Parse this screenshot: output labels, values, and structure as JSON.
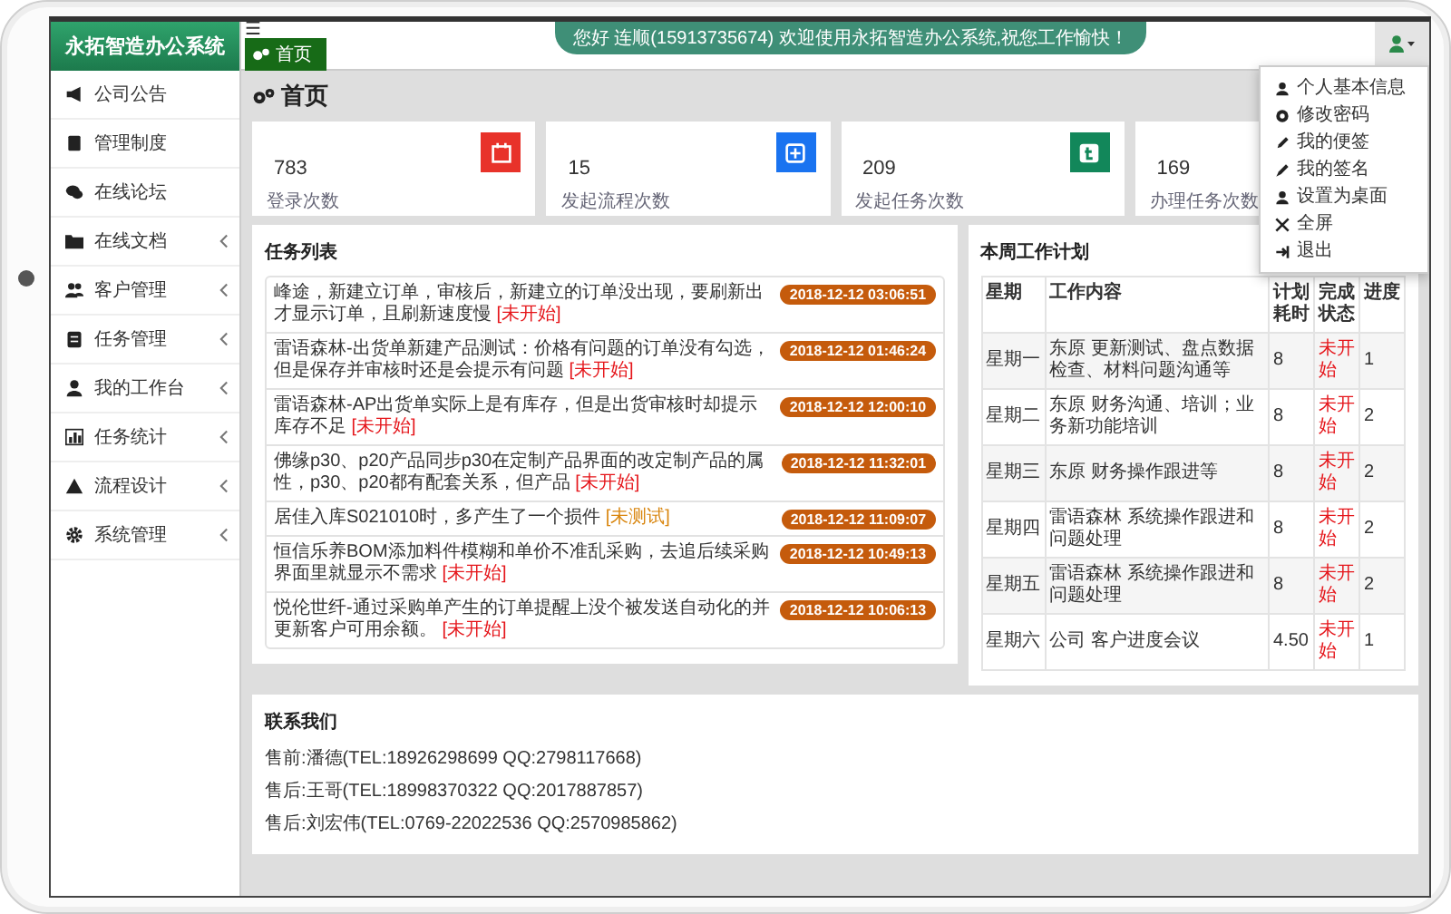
{
  "app": {
    "title": "永拓智造办公系统"
  },
  "sidebar": {
    "items": [
      {
        "label": "公司公告",
        "expandable": false
      },
      {
        "label": "管理制度",
        "expandable": false
      },
      {
        "label": "在线论坛",
        "expandable": false
      },
      {
        "label": "在线文档",
        "expandable": true
      },
      {
        "label": "客户管理",
        "expandable": true
      },
      {
        "label": "任务管理",
        "expandable": true
      },
      {
        "label": "我的工作台",
        "expandable": true
      },
      {
        "label": "任务统计",
        "expandable": true
      },
      {
        "label": "流程设计",
        "expandable": true
      },
      {
        "label": "系统管理",
        "expandable": true
      }
    ]
  },
  "topbar": {
    "menu_glyph": "☰",
    "tabs": [
      {
        "label": "首页",
        "selected": true
      }
    ],
    "welcome": "您好 连顺(15913735674) 欢迎使用永拓智造办公系统,祝您工作愉快！",
    "user_menu": {
      "expanded": true,
      "items": [
        "个人基本信息",
        "修改密码",
        "我的便签",
        "我的签名",
        "设置为桌面",
        "全屏",
        "退出"
      ]
    }
  },
  "page": {
    "title": "首页"
  },
  "stats": [
    {
      "value": "783",
      "label": "登录次数",
      "color": "#e8322a"
    },
    {
      "value": "15",
      "label": "发起流程次数",
      "color": "#1a73f0"
    },
    {
      "value": "209",
      "label": "发起任务次数",
      "color": "#12875a"
    },
    {
      "value": "169",
      "label": "办理任务次数"
    }
  ],
  "tasks": {
    "title": "任务列表",
    "items": [
      {
        "text": "峰途，新建立订单，审核后，新建立的订单没出现，要刷新出才显示订单，且刷新速度慢",
        "status": {
          "text": "[未开始]",
          "kind": "not-started"
        },
        "time": "2018-12-12 03:06:51"
      },
      {
        "text": "雷语森林-出货单新建产品测试：价格有问题的订单没有勾选，但是保存并审核时还是会提示有问题",
        "status": {
          "text": "[未开始]",
          "kind": "not-started"
        },
        "time": "2018-12-12 01:46:24"
      },
      {
        "text": "雷语森林-AP出货单实际上是有库存，但是出货审核时却提示库存不足",
        "status": {
          "text": "[未开始]",
          "kind": "not-started"
        },
        "time": "2018-12-12 12:00:10"
      },
      {
        "text": "佛缘p30、p20产品同步p30在定制产品界面的改定制产品的属性，p30、p20都有配套关系，但产品",
        "status": {
          "text": "[未开始]",
          "kind": "not-started"
        },
        "time": "2018-12-12 11:32:01"
      },
      {
        "text": "居佳入库S021010时，多产生了一个损件",
        "status": {
          "text": "[未测试]",
          "kind": "untested"
        },
        "time": "2018-12-12 11:09:07"
      },
      {
        "text": "恒信乐养BOM添加料件模糊和单价不准乱采购，去追后续采购界面里就显示不需求",
        "status": {
          "text": "[未开始]",
          "kind": "not-started"
        },
        "time": "2018-12-12 10:49:13"
      },
      {
        "text": "悦伦世纤-通过采购单产生的订单提醒上没个被发送自动化的并更新客户可用余额。",
        "status": {
          "text": "[未开始]",
          "kind": "not-started"
        },
        "time": "2018-12-12 10:06:13"
      }
    ]
  },
  "plan": {
    "title": "本周工作计划",
    "columns": [
      "星期",
      "工作内容",
      "计划耗时",
      "完成状态",
      "进度"
    ],
    "rows": [
      {
        "day": "星期一",
        "content": "东原 更新测试、盘点数据检查、材料问题沟通等",
        "hours": "8",
        "status": {
          "text": "未开始",
          "kind": "not-started"
        },
        "level": "1"
      },
      {
        "day": "星期二",
        "content": "东原 财务沟通、培训；业务新功能培训",
        "hours": "8",
        "status": {
          "text": "未开始",
          "kind": "not-started"
        },
        "level": "2"
      },
      {
        "day": "星期三",
        "content": "东原 财务操作跟进等",
        "hours": "8",
        "status": {
          "text": "未开始",
          "kind": "not-started"
        },
        "level": "2"
      },
      {
        "day": "星期四",
        "content": "雷语森林 系统操作跟进和问题处理",
        "hours": "8",
        "status": {
          "text": "未开始",
          "kind": "not-started"
        },
        "level": "2"
      },
      {
        "day": "星期五",
        "content": "雷语森林 系统操作跟进和问题处理",
        "hours": "8",
        "status": {
          "text": "未开始",
          "kind": "not-started"
        },
        "level": "2"
      },
      {
        "day": "星期六",
        "content": "公司 客户进度会议",
        "hours": "4.50",
        "status": {
          "text": "未开始",
          "kind": "not-started"
        },
        "level": "1"
      }
    ]
  },
  "contacts": {
    "title": "联系我们",
    "lines": [
      "售前:潘德(TEL:18926298699 QQ:2798117668)",
      "售后:王哥(TEL:18998370322 QQ:2017887857)",
      "售后:刘宏伟(TEL:0769-22022536 QQ:2570985862)"
    ]
  }
}
